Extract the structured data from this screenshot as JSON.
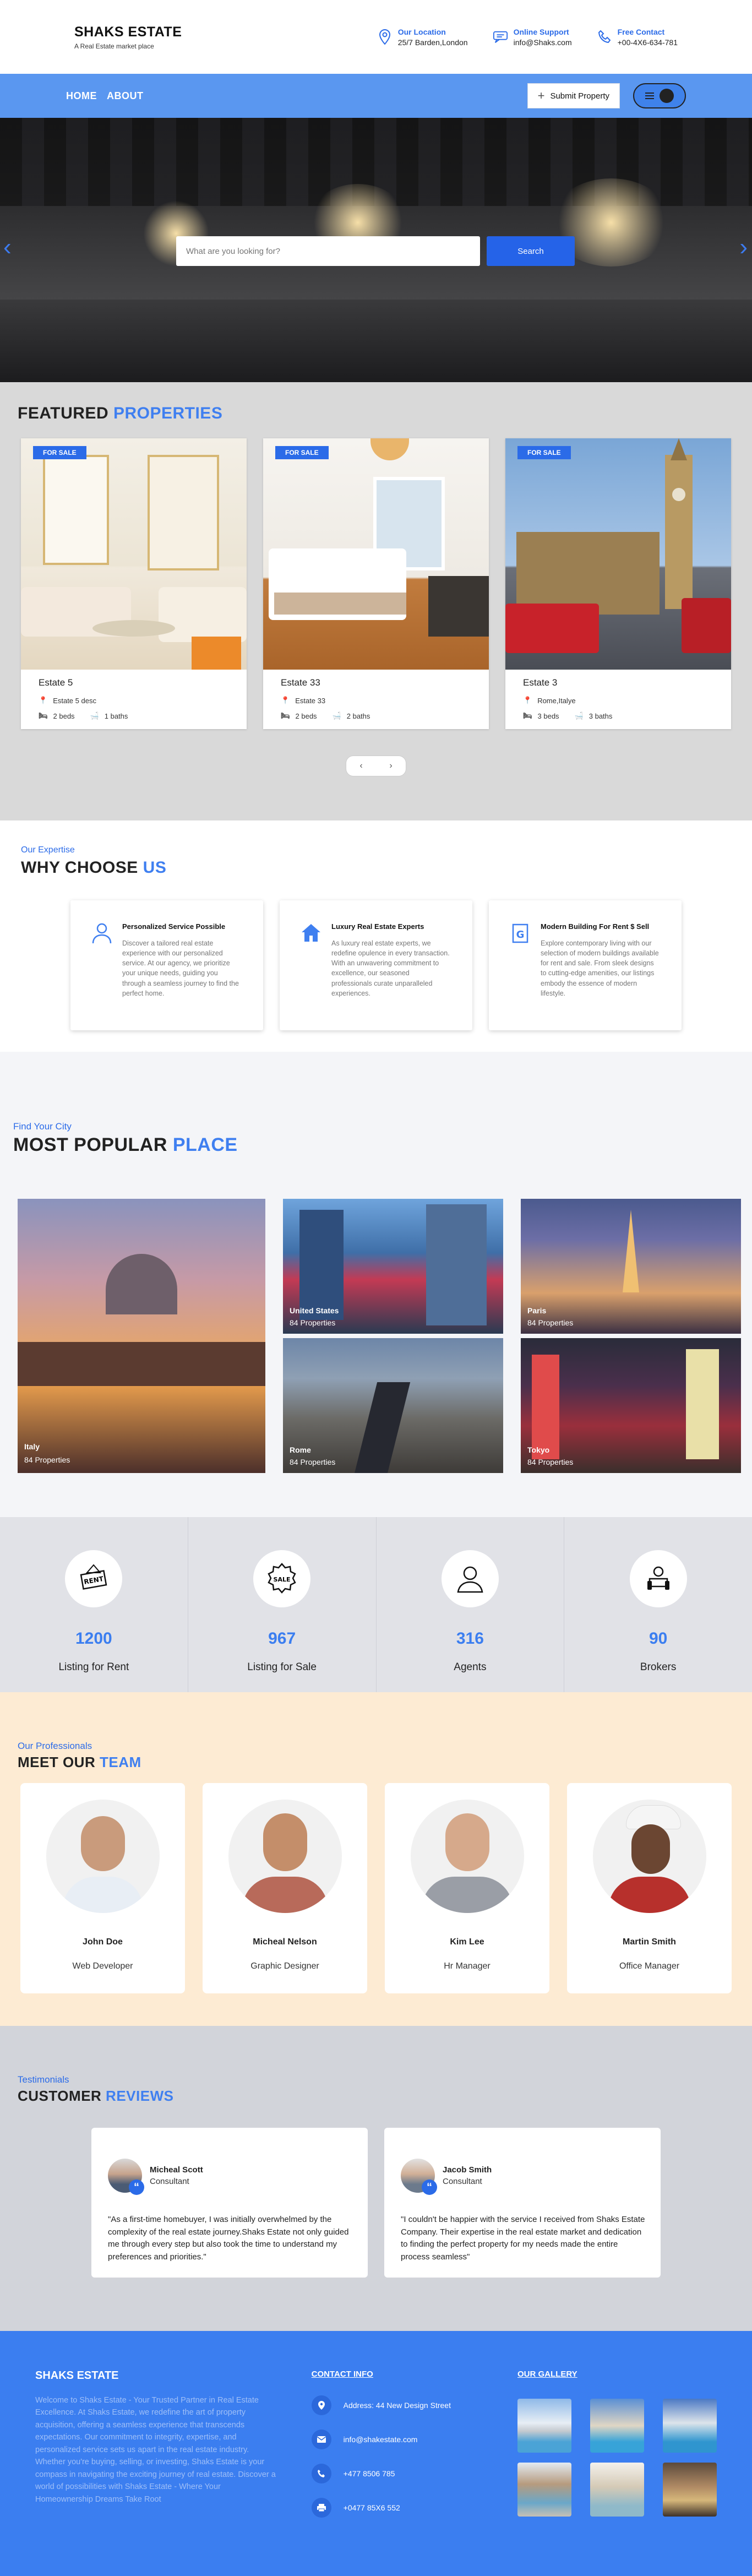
{
  "header": {
    "brand": "SHAKS ESTATE",
    "tagline": "A Real Estate market place",
    "contacts": [
      {
        "title": "Our Location",
        "value": "25/7 Barden,London",
        "icon": "location-pin-icon"
      },
      {
        "title": "Online Support",
        "value": "info@Shaks.com",
        "icon": "chat-icon"
      },
      {
        "title": "Free Contact",
        "value": "+00-4X6-634-781",
        "icon": "phone-icon"
      }
    ]
  },
  "nav": {
    "links": [
      "HOME",
      "ABOUT"
    ],
    "submit_label": "Submit Property",
    "submit_icon": "plus-icon",
    "menu_icon": "hamburger-icon"
  },
  "hero": {
    "search_placeholder": "What are you looking for?",
    "search_button": "Search",
    "prev_icon": "chevron-left-icon",
    "next_icon": "chevron-right-icon"
  },
  "featured": {
    "title_a": "FEATURED",
    "title_b": "PROPERTIES",
    "cards": [
      {
        "badge": "FOR SALE",
        "name": "Estate 5",
        "location": "Estate 5 desc",
        "beds": "2 beds",
        "baths": "1 baths"
      },
      {
        "badge": "FOR SALE",
        "name": "Estate 33",
        "location": "Estate 33",
        "beds": "2 beds",
        "baths": "2 baths"
      },
      {
        "badge": "FOR SALE",
        "name": "Estate 3",
        "location": "Rome,Italye",
        "beds": "3 beds",
        "baths": "3 baths"
      }
    ],
    "pager_prev": "‹",
    "pager_next": "›"
  },
  "why": {
    "subtitle": "Our Expertise",
    "title_a": "WHY CHOOSE",
    "title_b": "US",
    "cards": [
      {
        "icon": "person-icon",
        "title": "Personalized Service Possible",
        "desc": "Discover a tailored real estate experience with our personalized service. At our agency, we prioritize your unique needs, guiding you through a seamless journey to find the perfect home."
      },
      {
        "icon": "house-icon",
        "title": "Luxury Real Estate Experts",
        "desc": "As luxury real estate experts, we redefine opulence in every transaction. With an unwavering commitment to excellence, our seasoned professionals curate unparalleled experiences."
      },
      {
        "icon": "building-icon",
        "title": "Modern Building For Rent $ Sell",
        "desc": "Explore contemporary living with our selection of modern buildings available for rent and sale. From sleek designs to cutting-edge amenities, our listings embody the essence of modern lifestyle."
      }
    ]
  },
  "popular": {
    "subtitle": "Find Your City",
    "title_a": "MOST POPULAR",
    "title_b": "PLACE",
    "cities": [
      {
        "name": "Italy",
        "count": "84 Properties"
      },
      {
        "name": "United States",
        "count": "84 Properties"
      },
      {
        "name": "Paris",
        "count": "84 Properties"
      },
      {
        "name": "Rome",
        "count": "84 Properties"
      },
      {
        "name": "Tokyo",
        "count": "84 Properties"
      }
    ]
  },
  "stats": [
    {
      "icon": "rent-sign-icon",
      "value": "1200",
      "label": "Listing for Rent"
    },
    {
      "icon": "sale-tag-icon",
      "value": "967",
      "label": "Listing for Sale"
    },
    {
      "icon": "agent-icon",
      "value": "316",
      "label": "Agents"
    },
    {
      "icon": "broker-icon",
      "value": "90",
      "label": "Brokers"
    }
  ],
  "team": {
    "subtitle": "Our Professionals",
    "title_a": "MEET OUR",
    "title_b": "TEAM",
    "members": [
      {
        "name": "John Doe",
        "role": "Web Developer"
      },
      {
        "name": "Micheal Nelson",
        "role": "Graphic Designer"
      },
      {
        "name": "Kim Lee",
        "role": "Hr Manager"
      },
      {
        "name": "Martin Smith",
        "role": "Office Manager"
      }
    ]
  },
  "reviews": {
    "subtitle": "Testimonials",
    "title_a": "CUSTOMER",
    "title_b": "REVIEWS",
    "items": [
      {
        "name": "Micheal Scott",
        "role": "Consultant",
        "text": "\"As a first-time homebuyer, I was initially overwhelmed by the complexity of the real estate journey.Shaks Estate not only guided me through every step but also took the time to understand my preferences and priorities.\""
      },
      {
        "name": "Jacob Smith",
        "role": "Consultant",
        "text": "\"I couldn't be happier with the service I received from Shaks Estate Company. Their expertise in the real estate market and dedication to finding the perfect property for my needs made the entire process seamless\""
      }
    ]
  },
  "footer": {
    "brand": "SHAKS ESTATE",
    "about": "Welcome to Shaks Estate - Your Trusted Partner in Real Estate Excellence. At Shaks Estate, we redefine the art of property acquisition, offering a seamless experience that transcends expectations. Our commitment to integrity, expertise, and personalized service sets us apart in the real estate industry. Whether you're buying, selling, or investing, Shaks Estate is your compass in navigating the exciting journey of real estate. Discover a world of possibilities with Shaks Estate - Where Your Homeownership Dreams Take Root",
    "contact_title": "CONTACT INFO",
    "contacts": [
      {
        "icon": "location-pin-icon",
        "text": "Address: 44 New Design Street"
      },
      {
        "icon": "mail-icon",
        "text": "info@shakestate.com"
      },
      {
        "icon": "phone-icon",
        "text": "+477 8506 785"
      },
      {
        "icon": "printer-icon",
        "text": "+0477 85X6 552"
      }
    ],
    "gallery_title": "OUR GALLERY"
  },
  "colors": {
    "accent": "#3f7ff0",
    "nav": "#5a97f0",
    "footer": "#3b7ef0",
    "team_bg": "#fdebd3",
    "reviews_bg": "#d2d4da"
  }
}
